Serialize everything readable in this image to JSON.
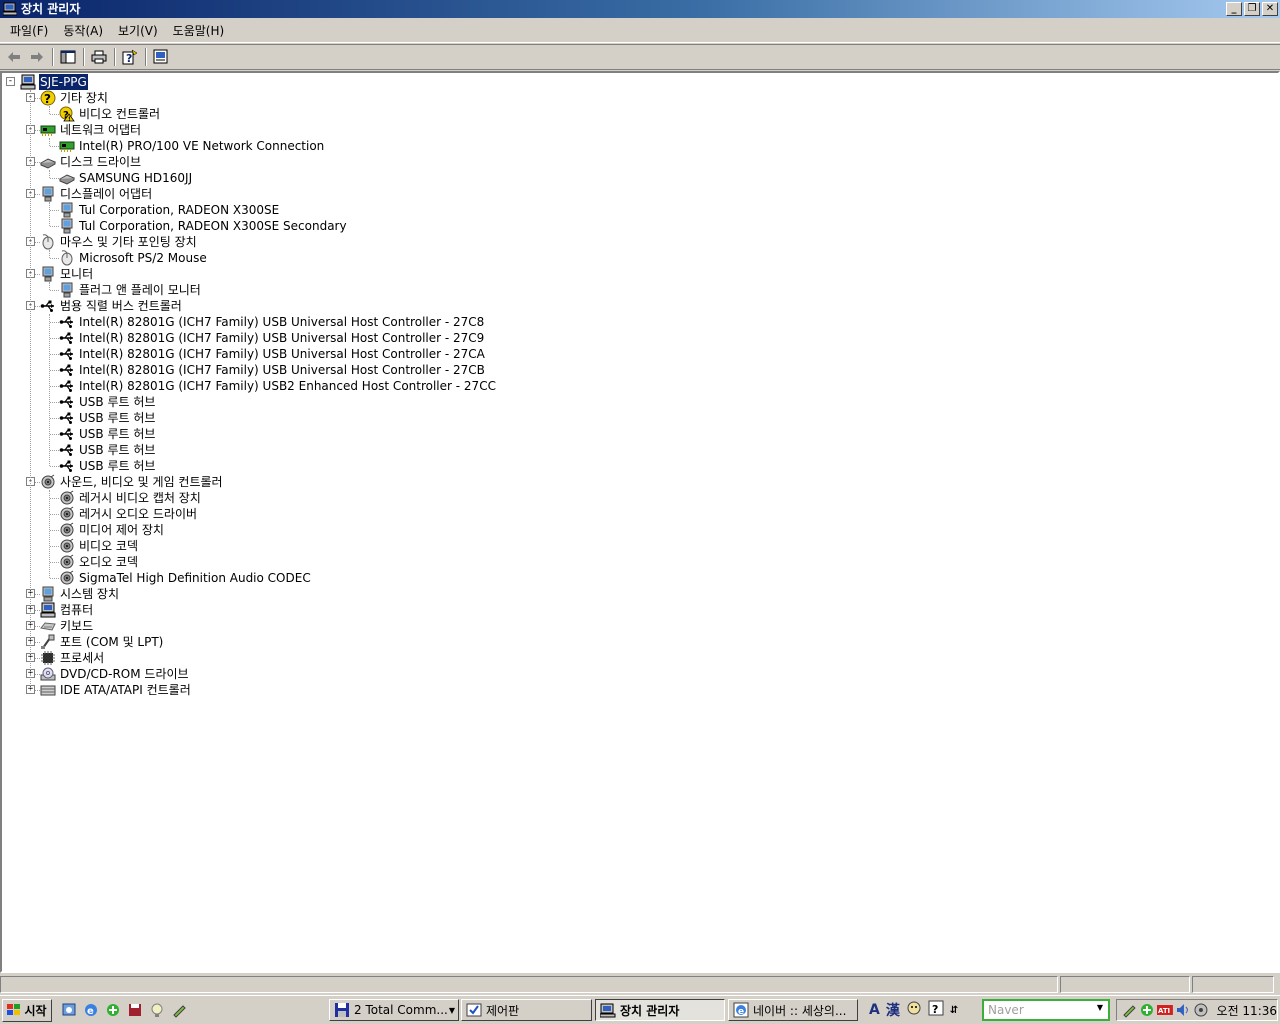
{
  "window": {
    "title": "장치 관리자",
    "buttons": [
      "_",
      "❐",
      "✕"
    ]
  },
  "menu": [
    "파일(F)",
    "동작(A)",
    "보기(V)",
    "도움말(H)"
  ],
  "toolbar": {
    "icons": [
      "back-arrow-icon",
      "forward-arrow-icon",
      "show-hide-tree-icon",
      "print-icon",
      "help-icon",
      "properties-icon"
    ]
  },
  "tree": {
    "root": "SJE-PPG",
    "categories": [
      {
        "label": "기타 장치",
        "expanded": true,
        "icon": "unknown-device-icon",
        "children": [
          "비디오 컨트롤러"
        ]
      },
      {
        "label": "네트워크 어댑터",
        "expanded": true,
        "icon": "network-adapter-icon",
        "children": [
          "Intel(R) PRO/100 VE Network Connection"
        ]
      },
      {
        "label": "디스크 드라이브",
        "expanded": true,
        "icon": "disk-drive-icon",
        "children": [
          "SAMSUNG HD160JJ"
        ]
      },
      {
        "label": "디스플레이 어댑터",
        "expanded": true,
        "icon": "display-adapter-icon",
        "children": [
          "Tul Corporation, RADEON  X300SE",
          "Tul Corporation, RADEON  X300SE Secondary"
        ]
      },
      {
        "label": "마우스 및 기타 포인팅 장치",
        "expanded": true,
        "icon": "mouse-icon",
        "children": [
          "Microsoft PS/2 Mouse"
        ]
      },
      {
        "label": "모니터",
        "expanded": true,
        "icon": "monitor-icon",
        "children": [
          "플러그 앤 플레이 모니터"
        ]
      },
      {
        "label": "범용 직렬 버스 컨트롤러",
        "expanded": true,
        "icon": "usb-icon",
        "children": [
          "Intel(R) 82801G (ICH7 Family) USB Universal Host Controller - 27C8",
          "Intel(R) 82801G (ICH7 Family) USB Universal Host Controller - 27C9",
          "Intel(R) 82801G (ICH7 Family) USB Universal Host Controller - 27CA",
          "Intel(R) 82801G (ICH7 Family) USB Universal Host Controller - 27CB",
          "Intel(R) 82801G (ICH7 Family) USB2 Enhanced Host Controller - 27CC",
          "USB 루트 허브",
          "USB 루트 허브",
          "USB 루트 허브",
          "USB 루트 허브",
          "USB 루트 허브"
        ]
      },
      {
        "label": "사운드, 비디오 및 게임 컨트롤러",
        "expanded": true,
        "icon": "sound-icon",
        "children": [
          "레거시 비디오 캡처 장치",
          "레거시 오디오 드라이버",
          "미디어 제어 장치",
          "비디오 코덱",
          "오디오 코덱",
          "SigmaTel High Definition Audio CODEC"
        ]
      },
      {
        "label": "시스템 장치",
        "expanded": false,
        "icon": "system-device-icon",
        "children": []
      },
      {
        "label": "컴퓨터",
        "expanded": false,
        "icon": "computer-icon",
        "children": []
      },
      {
        "label": "키보드",
        "expanded": false,
        "icon": "keyboard-icon",
        "children": []
      },
      {
        "label": "포트 (COM 및 LPT)",
        "expanded": false,
        "icon": "port-icon",
        "children": []
      },
      {
        "label": "프로세서",
        "expanded": false,
        "icon": "processor-icon",
        "children": []
      },
      {
        "label": "DVD/CD-ROM 드라이브",
        "expanded": false,
        "icon": "cdrom-icon",
        "children": []
      },
      {
        "label": "IDE ATA/ATAPI 컨트롤러",
        "expanded": false,
        "icon": "ide-controller-icon",
        "children": []
      }
    ]
  },
  "taskbar": {
    "start_label": "시작",
    "tasks": [
      "2 Total Comm...",
      "제어판",
      "장치 관리자",
      "네이버 :: 세상의..."
    ],
    "active_task": "장치 관리자",
    "ime": [
      "A",
      "漢"
    ],
    "search_placeholder": "Naver",
    "clock": "오전 11:36"
  },
  "colors": {
    "titlebar_start": "#0a246a",
    "titlebar_end": "#a6caf0",
    "selection": "#0a246a",
    "face": "#d4d0c8",
    "search_border": "#3ab03a"
  }
}
